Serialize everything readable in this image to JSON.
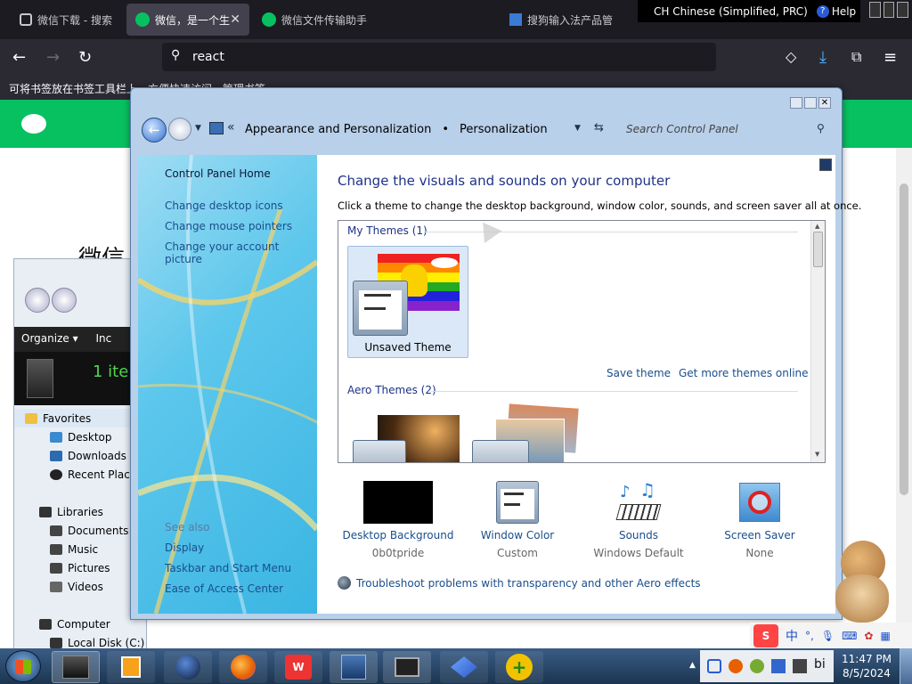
{
  "browser": {
    "tabs": [
      {
        "label": "微信下载 - 搜索",
        "active": false
      },
      {
        "label": "微信，是一个生",
        "active": true
      },
      {
        "label": "微信文件传输助手",
        "active": false
      },
      {
        "label": "搜狗输入法产品管",
        "active": false
      }
    ],
    "url": "react",
    "bookmark_hint": "可将书签放在书签工具栏上，方便快速访问。管理书签…"
  },
  "ime": {
    "language": "CH Chinese (Simplified, PRC)",
    "help": "Help"
  },
  "page": {
    "heading_partial": "微信"
  },
  "explorer": {
    "organize": "Organize ▾",
    "incl": "Inc",
    "items_count": "1 ite",
    "nav": [
      "Favorites",
      "Desktop",
      "Downloads",
      "Recent Places",
      "Libraries",
      "Documents",
      "Music",
      "Pictures",
      "Videos",
      "Computer",
      "Local Disk (C:)"
    ]
  },
  "cp": {
    "breadcrumb_root": "Appearance and Personalization",
    "breadcrumb_sep": "•",
    "breadcrumb_leaf": "Personalization",
    "search_placeholder": "Search Control Panel",
    "home": "Control Panel Home",
    "links": [
      "Change desktop icons",
      "Change mouse pointers",
      "Change your account picture"
    ],
    "see_also": "See also",
    "see_also_links": [
      "Display",
      "Taskbar and Start Menu",
      "Ease of Access Center"
    ],
    "title": "Change the visuals and sounds on your computer",
    "subtitle": "Click a theme to change the desktop background, window color, sounds, and screen saver all at once.",
    "my_themes": "My Themes (1)",
    "unsaved_theme": "Unsaved Theme",
    "save_theme": "Save theme",
    "get_more": "Get more themes online",
    "aero_themes": "Aero Themes (2)",
    "bottom": [
      {
        "label": "Desktop Background",
        "value": "0b0tpride"
      },
      {
        "label": "Window Color",
        "value": "Custom"
      },
      {
        "label": "Sounds",
        "value": "Windows Default"
      },
      {
        "label": "Screen Saver",
        "value": "None"
      }
    ],
    "troubleshoot": "Troubleshoot problems with transparency and other Aero effects"
  },
  "taskbar": {
    "time": "11:47 PM",
    "date": "8/5/2024",
    "tray_text": "中",
    "tray_partial": "bi"
  },
  "colors": {
    "taskbar": "#1b3550",
    "wechat_green": "#07c160",
    "link": "#1a4e8c",
    "title": "#1e3287"
  }
}
